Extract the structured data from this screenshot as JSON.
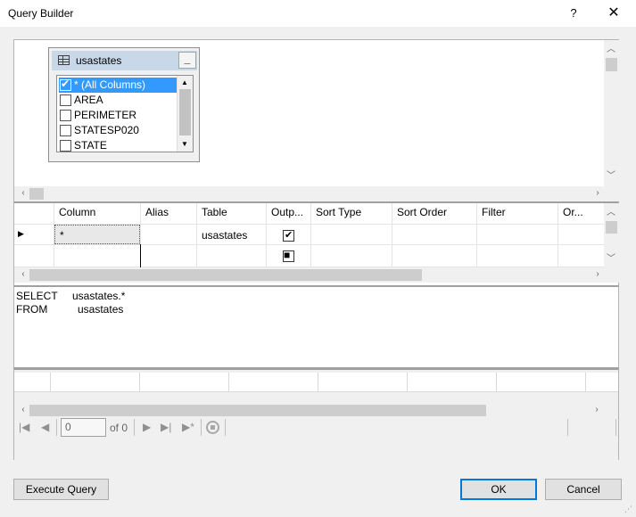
{
  "window": {
    "title": "Query Builder",
    "help_label": "?",
    "close_label": "✕"
  },
  "diagram": {
    "table_name": "usastates",
    "minimize_label": "_",
    "columns": [
      {
        "label": "* (All Columns)",
        "checked": true,
        "selected": true
      },
      {
        "label": "AREA",
        "checked": false
      },
      {
        "label": "PERIMETER",
        "checked": false
      },
      {
        "label": "STATESP020",
        "checked": false
      },
      {
        "label": "STATE",
        "checked": false
      }
    ]
  },
  "grid": {
    "headers": [
      "Column",
      "Alias",
      "Table",
      "Outp...",
      "Sort Type",
      "Sort Order",
      "Filter",
      "Or..."
    ],
    "rows": [
      {
        "column": "*",
        "alias": "",
        "table": "usastates",
        "output": true
      }
    ],
    "new_row_marker": "■"
  },
  "sql": {
    "lines": [
      {
        "keyword": "SELECT",
        "value": "usastates.*"
      },
      {
        "keyword": "FROM",
        "value": "usastates"
      }
    ]
  },
  "navigator": {
    "position": "0",
    "of_label": "of 0"
  },
  "buttons": {
    "execute": "Execute Query",
    "ok": "OK",
    "cancel": "Cancel"
  },
  "icons": {
    "first": "first-record-icon",
    "prev": "previous-record-icon",
    "next": "next-record-icon",
    "last": "last-record-icon",
    "new": "new-record-icon",
    "stop": "stop-icon"
  }
}
